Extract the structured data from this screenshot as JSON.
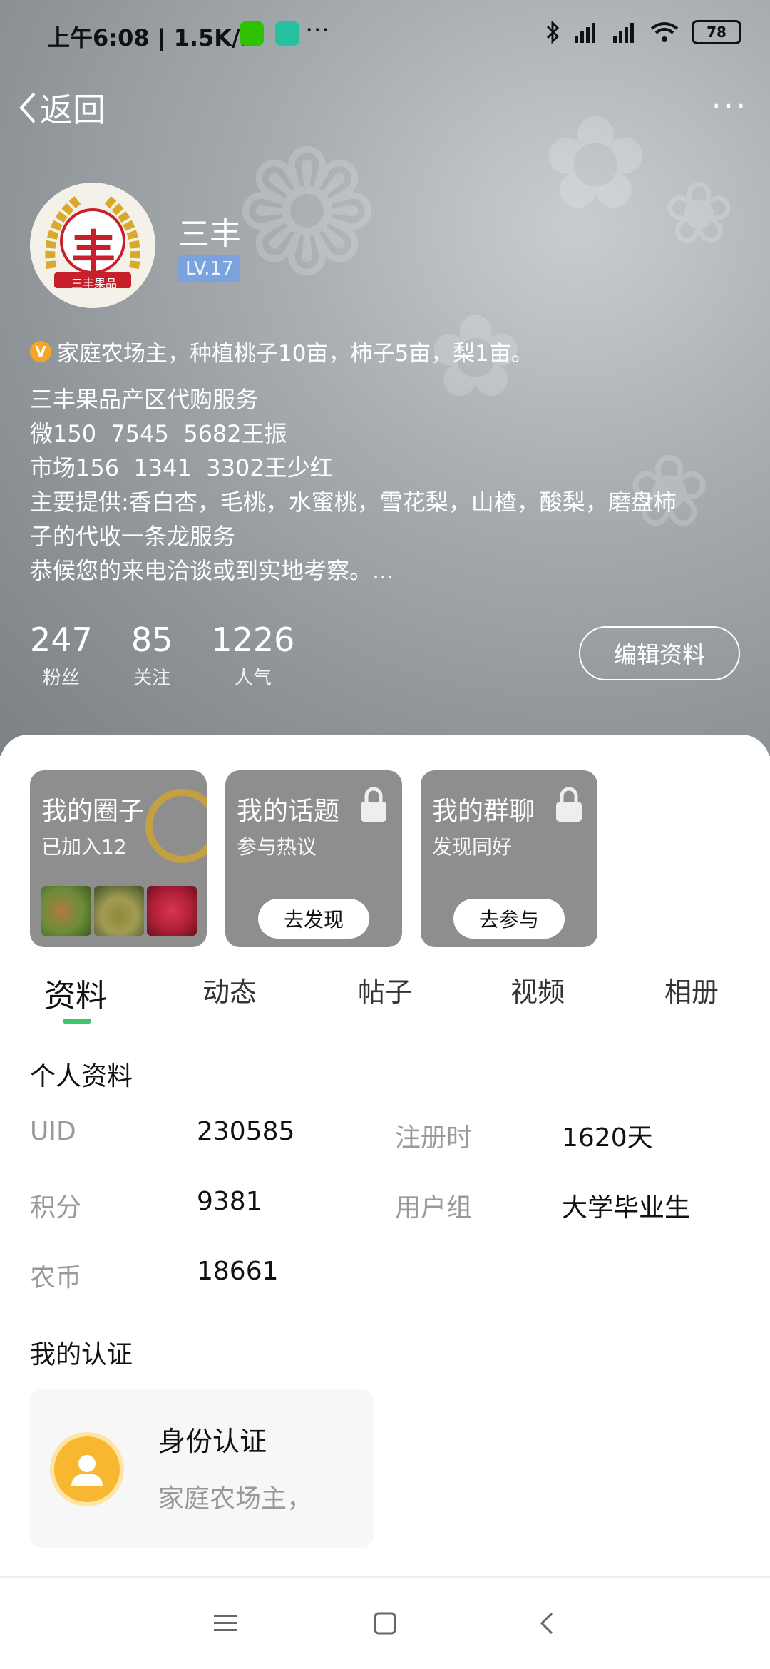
{
  "status_bar": {
    "time": "上午6:08 | 1.5K/s",
    "more": "···",
    "battery": "78"
  },
  "header": {
    "back_label": "返回",
    "more_label": "···"
  },
  "profile": {
    "avatar_text": "丰",
    "avatar_sub": "三丰果品",
    "name": "三丰",
    "level": "LV.17",
    "verified_badge": "V",
    "verified_text": "家庭农场主，种植桃子10亩，柿子5亩，梨1亩。",
    "bio_lines": [
      "三丰果品产区代购服务",
      "微150  7545  5682王振",
      "市场156  1341  3302王少红",
      "主要提供:香白杏，毛桃，水蜜桃，雪花梨，山楂，酸梨，磨盘柿",
      "子的代收一条龙服务",
      "恭候您的来电洽谈或到实地考察。..."
    ],
    "stats": [
      {
        "num": "247",
        "label": "粉丝"
      },
      {
        "num": "85",
        "label": "关注"
      },
      {
        "num": "1226",
        "label": "人气"
      }
    ],
    "edit_label": "编辑资料"
  },
  "cards": [
    {
      "title": "我的圈子",
      "sub": "已加入12"
    },
    {
      "title": "我的话题",
      "sub": "参与热议",
      "button": "去发现"
    },
    {
      "title": "我的群聊",
      "sub": "发现同好",
      "button": "去参与"
    }
  ],
  "tabs": [
    "资料",
    "动态",
    "帖子",
    "视频",
    "相册"
  ],
  "personal_info": {
    "title": "个人资料",
    "uid_label": "UID",
    "uid": "230585",
    "reg_label": "注册时",
    "reg": "1620天",
    "points_label": "积分",
    "points": "9381",
    "group_label": "用户组",
    "group": "大学毕业生",
    "coins_label": "农币",
    "coins": "18661"
  },
  "certification": {
    "title": "我的认证",
    "card_title": "身份认证",
    "card_desc": "家庭农场主，"
  },
  "colors": {
    "accent": "#3cc56b",
    "level_badge": "#7aa2df",
    "verified": "#f5a623"
  }
}
